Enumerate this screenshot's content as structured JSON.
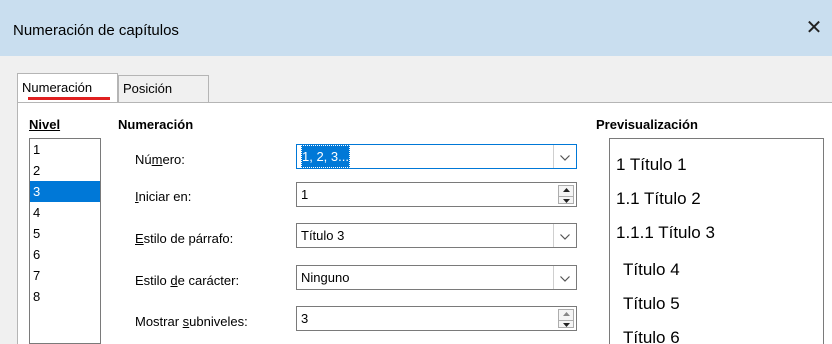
{
  "window": {
    "title": "Numeración de capítulos",
    "close_glyph": "✕",
    "close_icon": "close-icon"
  },
  "tabs": [
    {
      "label": "Numeración",
      "active": true
    },
    {
      "label": "Posición",
      "active": false
    }
  ],
  "level": {
    "heading": "Nivel",
    "items": [
      "1",
      "2",
      "3",
      "4",
      "5",
      "6",
      "7",
      "8"
    ],
    "selected": "3"
  },
  "numbering": {
    "heading": "Numeración",
    "number_label_pre": "Nú",
    "number_label_u": "m",
    "number_label_post": "ero:",
    "number_value": "1, 2, 3...",
    "start_label_pre": "",
    "start_label_u": "I",
    "start_label_post": "niciar en:",
    "start_value": "1",
    "paragraph_style_label_pre": "",
    "paragraph_style_label_u": "E",
    "paragraph_style_label_post": "stilo de párrafo:",
    "paragraph_style_value": "Título 3",
    "char_style_label_pre": "Estilo ",
    "char_style_label_u": "d",
    "char_style_label_post": "e carácter:",
    "char_style_value": "Ninguno",
    "sublevels_label_pre": "Mostrar ",
    "sublevels_label_u": "s",
    "sublevels_label_post": "ubniveles:",
    "sublevels_value": "3"
  },
  "preview": {
    "heading": "Previsualización",
    "lines": [
      "1 Título 1",
      "1.1 Título 2",
      "1.1.1 Título 3",
      "Título 4",
      "Título 5",
      "Título 6"
    ]
  },
  "colors": {
    "titlebar": "#c9deef",
    "selection": "#0078d7",
    "tab_underline": "#e02020"
  }
}
